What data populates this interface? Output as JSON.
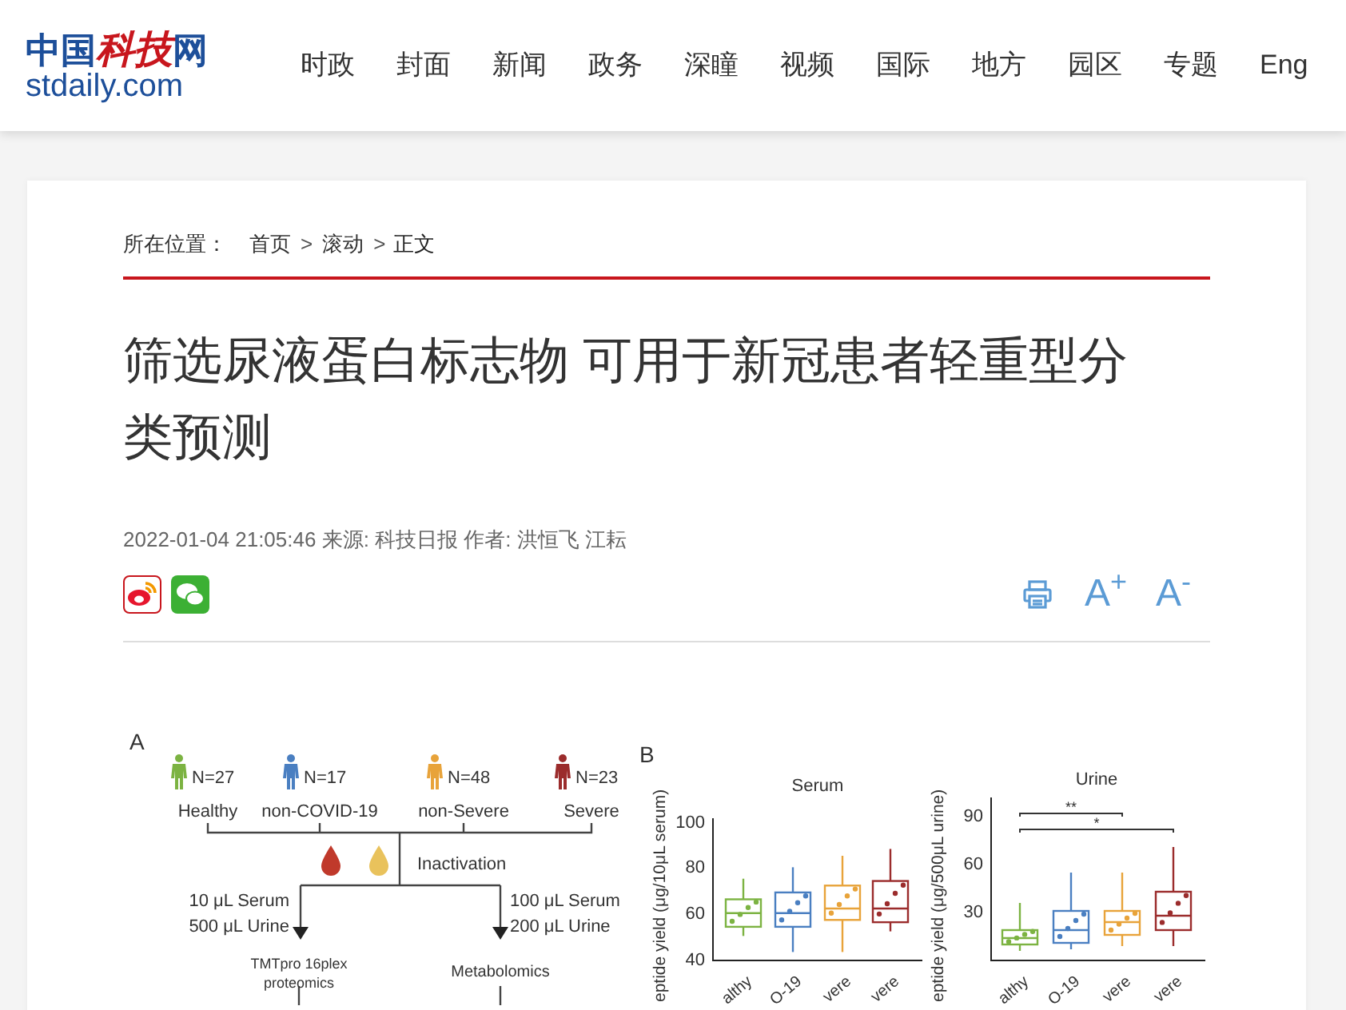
{
  "header": {
    "logo": {
      "cn_left": "中国",
      "cn_red": "科技",
      "cn_right": "网",
      "domain": "stdaily.com"
    },
    "nav": [
      "时政",
      "封面",
      "新闻",
      "政务",
      "深瞳",
      "视频",
      "国际",
      "地方",
      "园区",
      "专题",
      "Eng"
    ]
  },
  "breadcrumb": {
    "label": "所在位置：",
    "items": [
      {
        "kind": "link",
        "text": "首页"
      },
      {
        "kind": "separator",
        "text": ">"
      },
      {
        "kind": "link",
        "text": "滚动"
      },
      {
        "kind": "separator",
        "text": ">"
      },
      {
        "kind": "current",
        "text": "正文"
      }
    ]
  },
  "article": {
    "title": "筛选尿液蛋白标志物 可用于新冠患者轻重型分类预测",
    "meta": "2022-01-04 21:05:46 来源: 科技日报 作者: 洪恒飞 江耘",
    "tools": [
      {
        "kind": "print"
      },
      {
        "kind": "font",
        "text": "A$^{+}$"
      },
      {
        "kind": "font",
        "text": "A$^{-}$"
      }
    ],
    "figure": {
      "panel_a": {
        "label": "A",
        "groups": [
          {
            "count": "N=27",
            "name": "Healthy",
            "color": "#7cb342"
          },
          {
            "count": "N=17",
            "name": "non-COVID-19",
            "color": "#4a7fc1"
          },
          {
            "count": "N=48",
            "name": "non-Severe",
            "color": "#e8a33a"
          },
          {
            "count": "N=23",
            "name": "Severe",
            "color": "#9b2c2c"
          }
        ],
        "step": "Inactivation",
        "left_amounts": [
          "10 μL Serum",
          "500 μL Urine"
        ],
        "right_amounts": [
          "100 μL Serum",
          "200 μL Urine"
        ],
        "left_method": [
          "TMTpro 16plex",
          "proteomics"
        ],
        "right_method": "Metabolomics"
      },
      "panel_b": {
        "label": "B",
        "plots": [
          {
            "title": "Serum",
            "ylabel": "eptide yield (μg/10μL serum)",
            "yticks": [
              "100",
              "80",
              "60",
              "40"
            ],
            "xlabels": [
              "althy",
              "O-19",
              "vere",
              "vere"
            ]
          },
          {
            "title": "Urine",
            "ylabel": "eptide yield (μg/500μL urine)",
            "yticks": [
              "90",
              "60",
              "30"
            ],
            "xlabels": [
              "althy",
              "O-19",
              "vere",
              "vere"
            ],
            "significance": [
              "**",
              "*"
            ]
          }
        ]
      }
    }
  }
}
